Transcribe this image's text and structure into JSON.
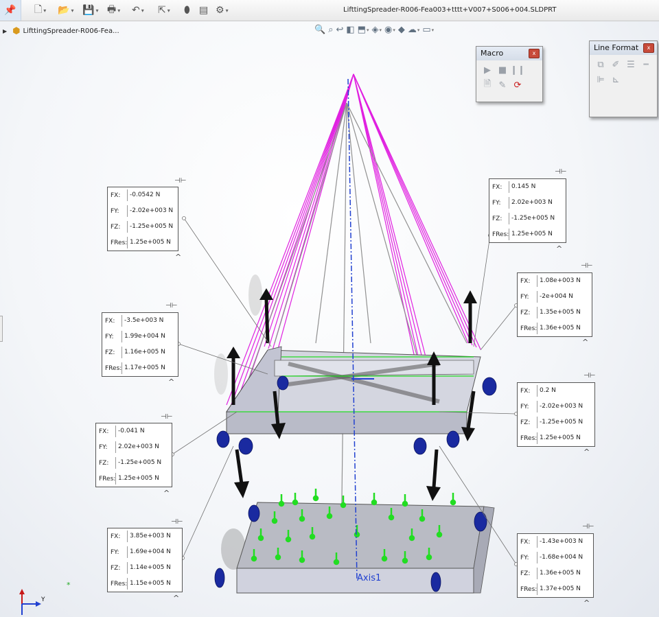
{
  "app": {
    "document_title": "LifttingSpreader-R006-Fea003+tttt+V007+S006+004.SLDPRT",
    "tree_item": "LifttingSpreader-R006-Fea..."
  },
  "toolbar_icons": [
    "pin-icon",
    "new-document-icon",
    "open-folder-icon",
    "save-icon",
    "print-icon",
    "undo-icon",
    "select-arrow-icon",
    "rebuild-icon",
    "file-properties-icon",
    "options-gear-icon"
  ],
  "hud_icons": [
    "zoom-to-fit-icon",
    "zoom-to-area-icon",
    "previous-view-icon",
    "section-view-icon",
    "view-orientation-icon",
    "display-style-icon",
    "hide-show-icon",
    "edit-appearance-icon",
    "apply-scene-icon",
    "view-settings-icon"
  ],
  "macro_panel": {
    "title": "Macro",
    "close": "x"
  },
  "line_format_panel": {
    "title": "Line Format",
    "close": "x"
  },
  "axis_label": "Axis1",
  "triad": {
    "y_label": "Y"
  },
  "callouts": [
    {
      "id": "c1",
      "fx": "-0.0542 N",
      "fy": "-2.02e+003 N",
      "fz": "-1.25e+005 N",
      "fres": "1.25e+005 N"
    },
    {
      "id": "c2",
      "fx": "0.145 N",
      "fy": "2.02e+003 N",
      "fz": "-1.25e+005 N",
      "fres": "1.25e+005 N"
    },
    {
      "id": "c3",
      "fx": "1.08e+003 N",
      "fy": "-2e+004 N",
      "fz": "1.35e+005 N",
      "fres": "1.36e+005 N"
    },
    {
      "id": "c4",
      "fx": "-3.5e+003 N",
      "fy": "1.99e+004 N",
      "fz": "1.16e+005 N",
      "fres": "1.17e+005 N"
    },
    {
      "id": "c5",
      "fx": "0.2 N",
      "fy": "-2.02e+003 N",
      "fz": "-1.25e+005 N",
      "fres": "1.25e+005 N"
    },
    {
      "id": "c6",
      "fx": "-0.041 N",
      "fy": "2.02e+003 N",
      "fz": "-1.25e+005 N",
      "fres": "1.25e+005 N"
    },
    {
      "id": "c7",
      "fx": "3.85e+003 N",
      "fy": "1.69e+004 N",
      "fz": "1.14e+005 N",
      "fres": "1.15e+005 N"
    },
    {
      "id": "c8",
      "fx": "-1.43e+003 N",
      "fy": "-1.68e+004 N",
      "fz": "1.36e+005 N",
      "fres": "1.37e+005 N"
    }
  ],
  "labels": {
    "fx": "FX:",
    "fy": "FY:",
    "fz": "FZ:",
    "fres": "FRes:"
  },
  "colors": {
    "sling": "#e020e0",
    "fixture": "#22dd22",
    "frame": "#c8cad6",
    "arrow": "#111111",
    "lug": "#1a2aa0",
    "axis": "#2040d0"
  }
}
